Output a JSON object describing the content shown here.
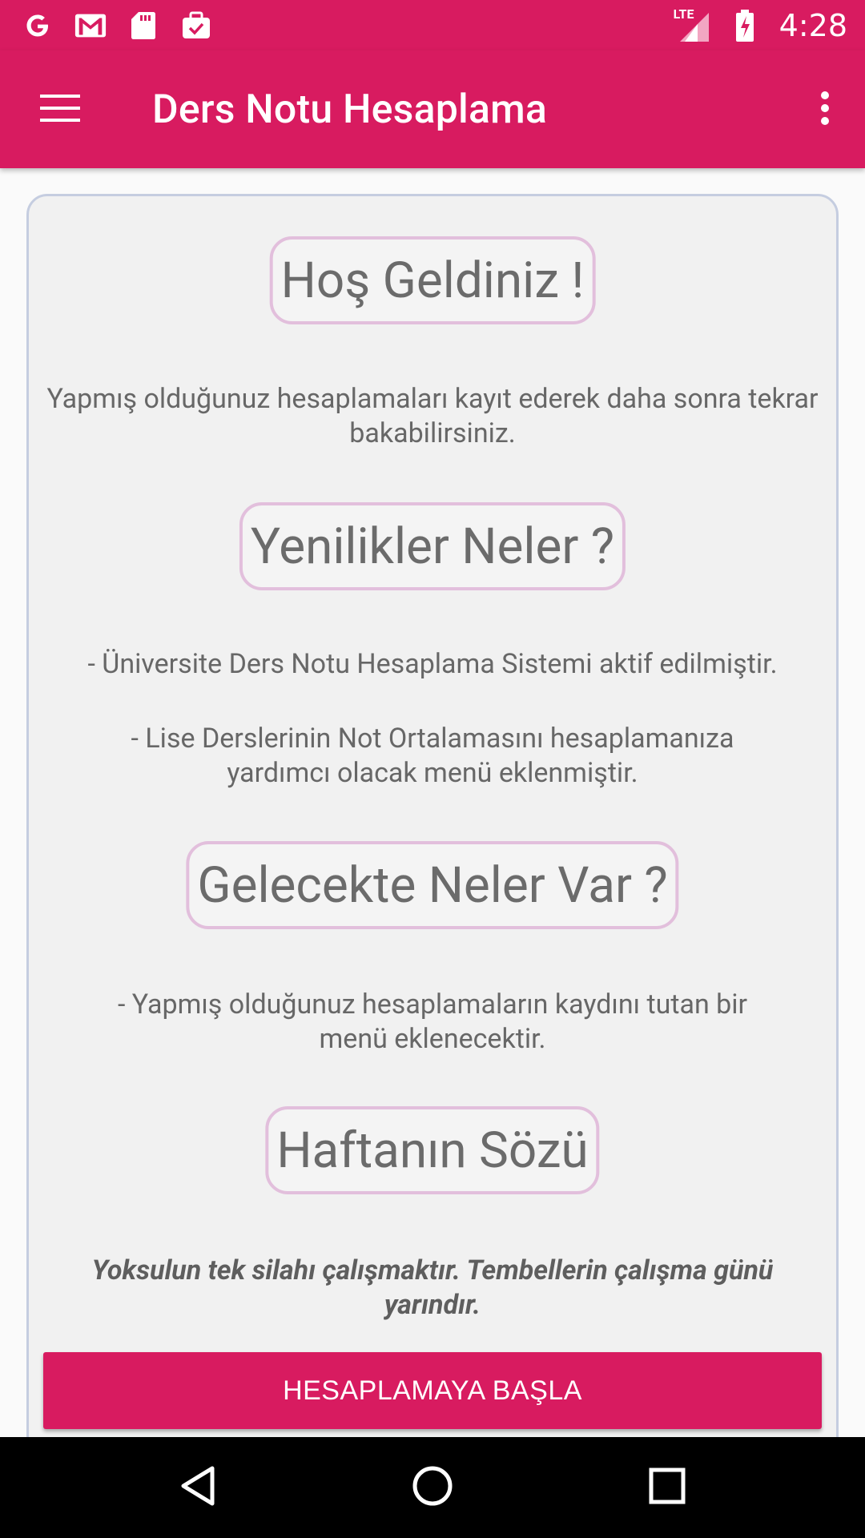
{
  "status_bar": {
    "time": "4:28",
    "network_label": "LTE",
    "icons": [
      "google-icon",
      "gmail-icon",
      "sd-card-icon",
      "briefcase-check-icon",
      "signal-icon",
      "battery-charging-icon"
    ]
  },
  "app_bar": {
    "title": "Ders Notu Hesaplama",
    "icons": [
      "hamburger-menu-icon",
      "overflow-menu-icon"
    ]
  },
  "main": {
    "welcome_heading": "Hoş Geldiniz !",
    "welcome_text": "Yapmış olduğunuz hesaplamaları kayıt ederek daha sonra tekrar bakabilirsiniz.",
    "news_heading": "Yenilikler Neler ?",
    "news_item_1": "- Üniversite Ders Notu Hesaplama Sistemi aktif edilmiştir.",
    "news_item_2": "- Lise Derslerinin Not Ortalamasını hesaplamanıza yardımcı olacak menü eklenmiştir.",
    "future_heading": "Gelecekte Neler Var ?",
    "future_item_1": "- Yapmış olduğunuz hesaplamaların kaydını tutan bir menü eklenecektir.",
    "quote_heading": "Haftanın Sözü",
    "quote_text": "Yoksulun tek silahı çalışmaktır. Tembellerin çalışma günü yarındır.",
    "start_button": "HESAPLAMAYA BAŞLA"
  },
  "nav_bar": {
    "icons": [
      "back-icon",
      "home-icon",
      "recents-icon"
    ]
  },
  "colors": {
    "primary": "#d81b60",
    "heading_border": "#e2bfdc",
    "card_border": "#c5cde0",
    "text": "#676767"
  }
}
